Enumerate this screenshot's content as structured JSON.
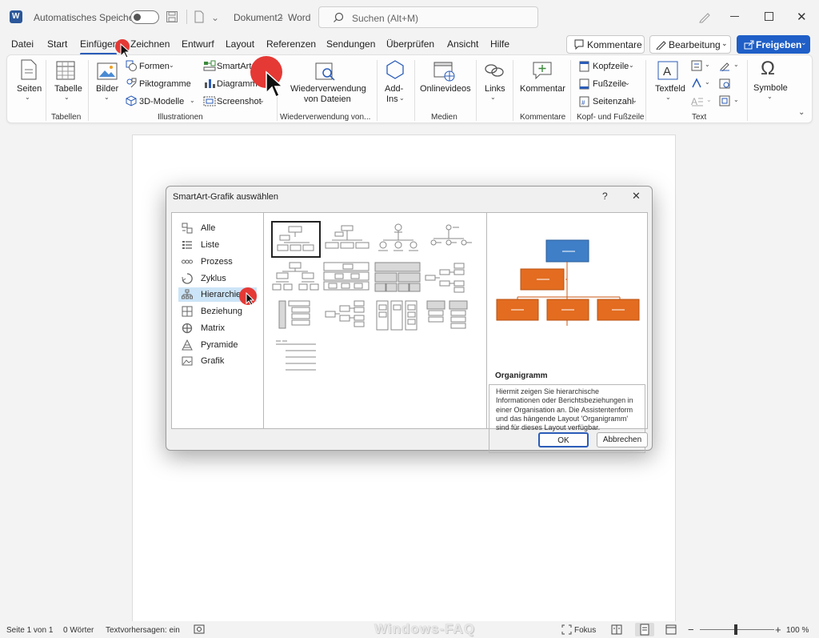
{
  "titlebar": {
    "autosave_label": "Automatisches Speichern",
    "doc_name": "Dokument2",
    "app_sep": "-",
    "app_name": "Word",
    "search_placeholder": "Suchen (Alt+M)"
  },
  "tabs": [
    "Datei",
    "Start",
    "Einfügen",
    "Zeichnen",
    "Entwurf",
    "Layout",
    "Referenzen",
    "Sendungen",
    "Überprüfen",
    "Ansicht",
    "Hilfe"
  ],
  "active_tab": "Einfügen",
  "top_buttons": {
    "comments": "Kommentare",
    "editing": "Bearbeitung",
    "share": "Freigeben"
  },
  "ribbon": {
    "seiten": "Seiten",
    "tabelle": "Tabelle",
    "bilder": "Bilder",
    "formen": "Formen",
    "piktogramme": "Piktogramme",
    "modelle3d": "3D-Modelle",
    "smartart": "SmartArt",
    "diagramm": "Diagramm",
    "screenshot": "Screenshot",
    "wiederverwendung_1": "Wiederverwendung",
    "wiederverwendung_2": "von Dateien",
    "addins_1": "Add-",
    "addins_2": "Ins",
    "onlinevideos": "Onlinevideos",
    "links": "Links",
    "kommentar": "Kommentar",
    "kopfzeile": "Kopfzeile",
    "fusszeile": "Fußzeile",
    "seitenzahl": "Seitenzahl",
    "textfeld": "Textfeld",
    "symbole": "Symbole",
    "groups": {
      "tabellen": "Tabellen",
      "illustrationen": "Illustrationen",
      "wiederverwendung": "Wiederverwendung von...",
      "medien": "Medien",
      "kommentare": "Kommentare",
      "kopf": "Kopf- und Fußzeile",
      "text": "Text"
    }
  },
  "dialog": {
    "title": "SmartArt-Grafik auswählen",
    "help": "?",
    "close": "✕",
    "categories": [
      "Alle",
      "Liste",
      "Prozess",
      "Zyklus",
      "Hierarchie",
      "Beziehung",
      "Matrix",
      "Pyramide",
      "Grafik"
    ],
    "selected_category": "Hierarchie",
    "desc_title": "Organigramm",
    "desc_text": "Hiermit zeigen Sie hierarchische Informationen oder Berichtsbeziehungen in einer Organisation an. Die Assistentenform und das hängende Layout 'Organigramm' sind für dieses Layout verfügbar.",
    "ok": "OK",
    "cancel": "Abbrechen"
  },
  "statusbar": {
    "page": "Seite 1 von 1",
    "words": "0 Wörter",
    "predictions": "Textvorhersagen: ein",
    "focus": "Fokus",
    "zoom": "100 %"
  },
  "watermark": "Windows-FAQ",
  "colors": {
    "accent": "#2a5cb8",
    "share": "#1f5fc7",
    "org_top": "#3f7fc8",
    "org_box": "#e36c20",
    "cursor_dot": "#e53935",
    "selected_cat": "#cce4f7"
  }
}
